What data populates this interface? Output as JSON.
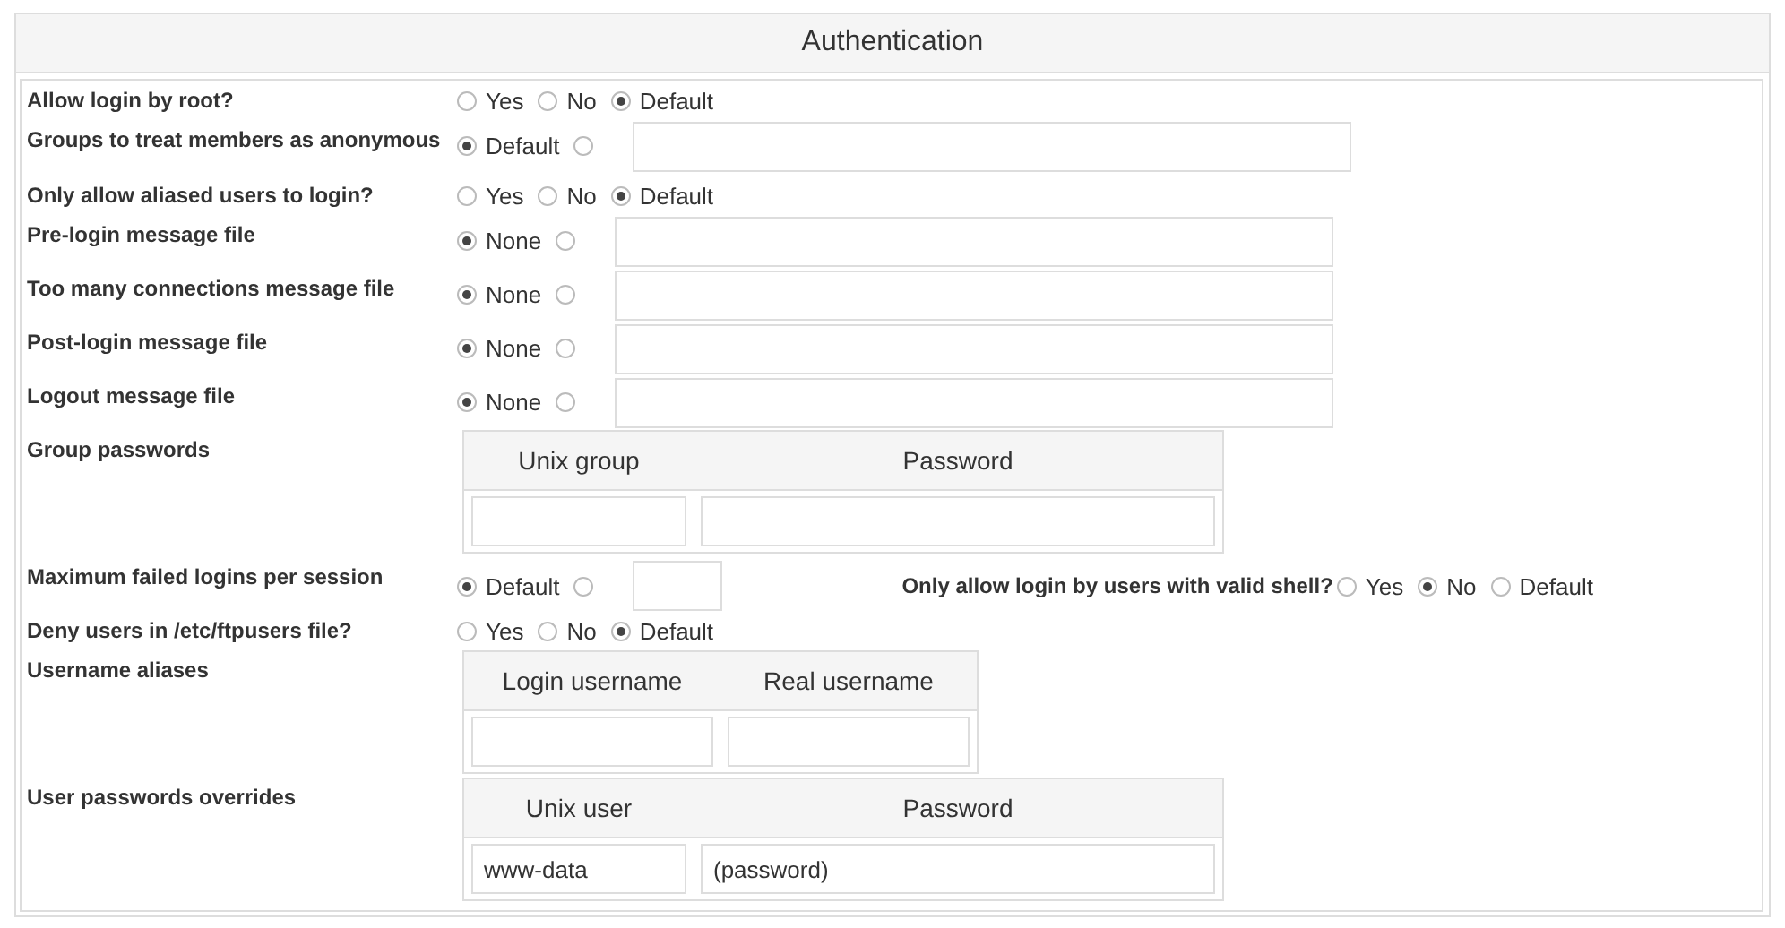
{
  "section": {
    "title": "Authentication"
  },
  "rows": [
    {
      "kind": "radios",
      "label": "Allow login by root?",
      "options": [
        {
          "label": "Yes",
          "selected": false
        },
        {
          "label": "No",
          "selected": false
        },
        {
          "label": "Default",
          "selected": true
        }
      ]
    },
    {
      "kind": "choice_wide",
      "label": "Groups to treat members as anonymous",
      "options": [
        {
          "label": "Default",
          "selected": true
        },
        {
          "selected": false
        }
      ]
    },
    {
      "kind": "radios",
      "label": "Only allow aliased users to login?",
      "options": [
        {
          "label": "Yes",
          "selected": false
        },
        {
          "label": "No",
          "selected": false
        },
        {
          "label": "Default",
          "selected": true
        }
      ]
    },
    {
      "kind": "choice_field",
      "label": "Pre-login message file",
      "options": [
        {
          "label": "None",
          "selected": true
        },
        {
          "selected": false
        }
      ]
    },
    {
      "kind": "choice_field",
      "label": "Too many connections message file",
      "options": [
        {
          "label": "None",
          "selected": true
        },
        {
          "selected": false
        }
      ]
    },
    {
      "kind": "choice_field",
      "label": "Post-login message file",
      "options": [
        {
          "label": "None",
          "selected": true
        },
        {
          "selected": false
        }
      ]
    },
    {
      "kind": "choice_field",
      "label": "Logout message file",
      "options": [
        {
          "label": "None",
          "selected": true
        },
        {
          "selected": false
        }
      ]
    },
    {
      "kind": "table_wide",
      "label": "Group passwords",
      "columns": [
        "Unix group",
        "Password"
      ]
    },
    {
      "kind": "pair",
      "label": "Maximum failed logins per session",
      "options": [
        {
          "label": "Default",
          "selected": true
        },
        {
          "selected": false
        }
      ],
      "right": {
        "label": "Only allow login by users with valid shell?",
        "options": [
          {
            "label": "Yes",
            "selected": false
          },
          {
            "label": "No",
            "selected": true
          },
          {
            "label": "Default",
            "selected": false
          }
        ]
      }
    },
    {
      "kind": "radios",
      "label": "Deny users in /etc/ftpusers file?",
      "options": [
        {
          "label": "Yes",
          "selected": false
        },
        {
          "label": "No",
          "selected": false
        },
        {
          "label": "Default",
          "selected": true
        }
      ]
    },
    {
      "kind": "table_narrow",
      "label": "Username aliases",
      "columns": [
        "Login username",
        "Real username"
      ]
    },
    {
      "kind": "table_wide",
      "label": "User passwords overrides",
      "columns": [
        "Unix user",
        "Password"
      ],
      "rows": [
        [
          "www-data",
          "(password)"
        ]
      ]
    }
  ]
}
